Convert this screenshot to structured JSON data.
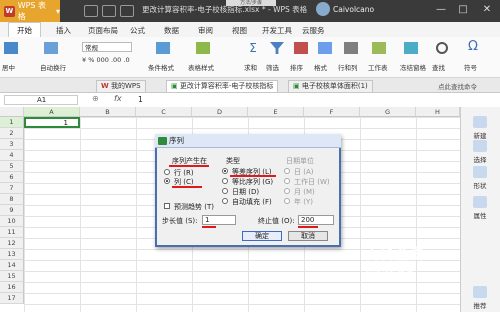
{
  "app": {
    "logo_label": "WPS 表格",
    "window_title": "更改计算容积率-电子校核指标.xlsx * - WPS 表格",
    "peek_tab": "方法/步骤",
    "user_name": "Caivolcano",
    "controls": [
      "—",
      "□",
      "✕"
    ]
  },
  "menu": {
    "tabs": [
      "开始",
      "插入",
      "页面布局",
      "公式",
      "数据",
      "审阅",
      "视图",
      "开发工具",
      "云服务"
    ],
    "active": "开始"
  },
  "ribbon": {
    "font_combo": "常规",
    "buttons": {
      "wrap": "自动换行",
      "cond_format": "条件格式",
      "table_style": "表格样式",
      "sum": "求和",
      "filter": "筛选",
      "sort": "排序",
      "format": "格式",
      "rowcol": "行和列",
      "sheet": "工作表",
      "freeze": "冻结窗格",
      "find": "查找",
      "symbol": "符号",
      "merge_center": "居中"
    },
    "format_symbols": [
      "¥",
      "%",
      "000",
      ".00",
      ".0"
    ]
  },
  "doc_tabs": [
    {
      "label": "我的WPS",
      "active": false
    },
    {
      "label": "更改计算容积率-电子校核指标",
      "active": true
    },
    {
      "label": "电子校核单体面积(1)",
      "active": false
    }
  ],
  "doc_tabs_right": "点此查找命令",
  "formula_bar": {
    "name_box": "A1",
    "fx": "fx",
    "value": "1"
  },
  "sheet": {
    "columns": [
      "A",
      "B",
      "C",
      "D",
      "E",
      "F",
      "G",
      "H"
    ],
    "rows": [
      "1",
      "2",
      "3",
      "4",
      "5",
      "6",
      "7",
      "8",
      "9",
      "10",
      "11",
      "12",
      "13",
      "14",
      "15",
      "16",
      "17"
    ],
    "a1_value": "1"
  },
  "sidebar": {
    "items": [
      {
        "label": "新建",
        "icon": "new-icon"
      },
      {
        "label": "选择",
        "icon": "select-icon"
      },
      {
        "label": "形状",
        "icon": "shape-icon"
      },
      {
        "label": "属性",
        "icon": "property-icon"
      },
      {
        "label": "推荐",
        "icon": "recommend-icon"
      }
    ]
  },
  "dialog": {
    "title": "序列",
    "series_in": {
      "label": "序列产生在",
      "options": [
        "行 (R)",
        "列 (C)"
      ],
      "selected": 1
    },
    "type": {
      "label": "类型",
      "options": [
        "等差序列 (L)",
        "等比序列 (G)",
        "日期 (D)",
        "自动填充 (F)"
      ],
      "selected": 0
    },
    "date_unit": {
      "label": "日期单位",
      "options": [
        "日 (A)",
        "工作日 (W)",
        "月 (M)",
        "年 (Y)"
      ]
    },
    "trend_label": "预测趋势 (T)",
    "step_label": "步长值 (S):",
    "step_value": "1",
    "stop_label": "终止值 (O):",
    "stop_value": "200",
    "ok_label": "确定",
    "cancel_label": "取消"
  },
  "watermark": {
    "title": "百科全说",
    "subtitle": "助你轻松解决"
  },
  "colors": {
    "accent_orange": "#e8a52d",
    "highlight_red": "#e01a1a",
    "dialog_border": "#4a6fb0",
    "selection_green": "#2e8b3a"
  }
}
